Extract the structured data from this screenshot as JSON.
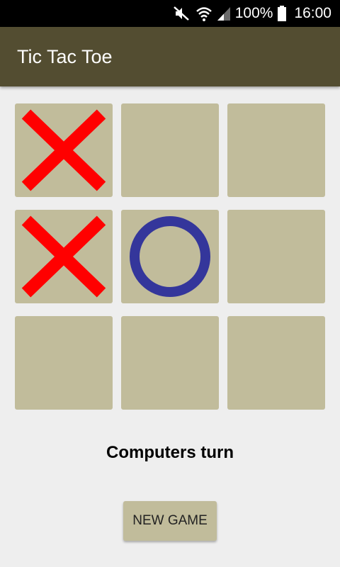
{
  "status_bar": {
    "battery": "100%",
    "time": "16:00",
    "icons": [
      "mute-icon",
      "wifi-icon",
      "signal-icon",
      "battery-icon"
    ]
  },
  "app_bar": {
    "title": "Tic Tac Toe",
    "color": "#534d31"
  },
  "board": {
    "cells": [
      [
        "X",
        "",
        ""
      ],
      [
        "X",
        "O",
        ""
      ],
      [
        "",
        "",
        ""
      ]
    ],
    "cell_color": "#c1bc9b",
    "x_color": "#ff0000",
    "o_color": "#34369b"
  },
  "status": {
    "turn_text": "Computers turn"
  },
  "actions": {
    "new_game_label": "NEW GAME"
  }
}
